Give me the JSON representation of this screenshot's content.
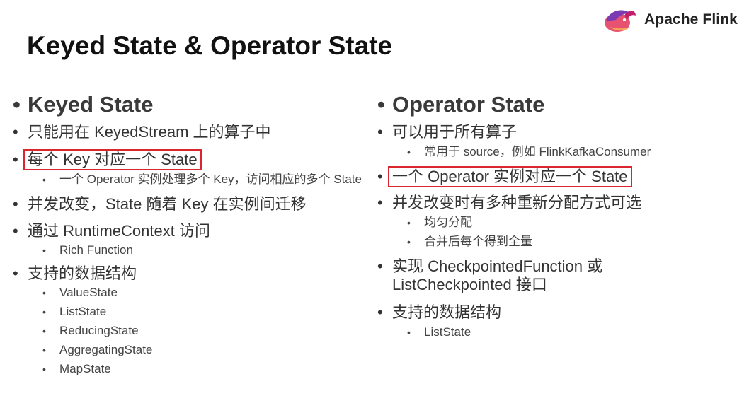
{
  "logo": {
    "text": "Apache Flink",
    "icon": "squirrel-logo-icon",
    "colors": [
      "#e6526f",
      "#bf1f6b",
      "#7b3cb3",
      "#f7a35a"
    ]
  },
  "title": "Keyed State & Operator State",
  "highlight_color": "#d9262f",
  "left": {
    "heading": "Keyed State",
    "items": [
      {
        "text": "只能用在 KeyedStream 上的算子中"
      },
      {
        "text": "每个 Key 对应一个 State",
        "highlighted": true
      },
      {
        "sub": "一个 Operator 实例处理多个 Key，访问相应的多个 State"
      },
      {
        "text": "并发改变，State 随着 Key 在实例间迁移"
      },
      {
        "text": "通过 RuntimeContext 访问"
      },
      {
        "sub": "Rich Function"
      },
      {
        "text": "支持的数据结构"
      },
      {
        "sub": "ValueState"
      },
      {
        "sub": "ListState"
      },
      {
        "sub": "ReducingState"
      },
      {
        "sub": "AggregatingState"
      },
      {
        "sub": "MapState"
      }
    ]
  },
  "right": {
    "heading": "Operator State",
    "items": [
      {
        "text": "可以用于所有算子"
      },
      {
        "sub": "常用于 source，例如 FlinkKafkaConsumer"
      },
      {
        "text": "一个 Operator 实例对应一个 State",
        "highlighted": true
      },
      {
        "text": "并发改变时有多种重新分配方式可选"
      },
      {
        "sub": "均匀分配"
      },
      {
        "sub": "合并后每个得到全量"
      },
      {
        "text": "实现 CheckpointedFunction 或 ListCheckpointed 接口"
      },
      {
        "text": "支持的数据结构"
      },
      {
        "sub": "ListState"
      }
    ]
  }
}
